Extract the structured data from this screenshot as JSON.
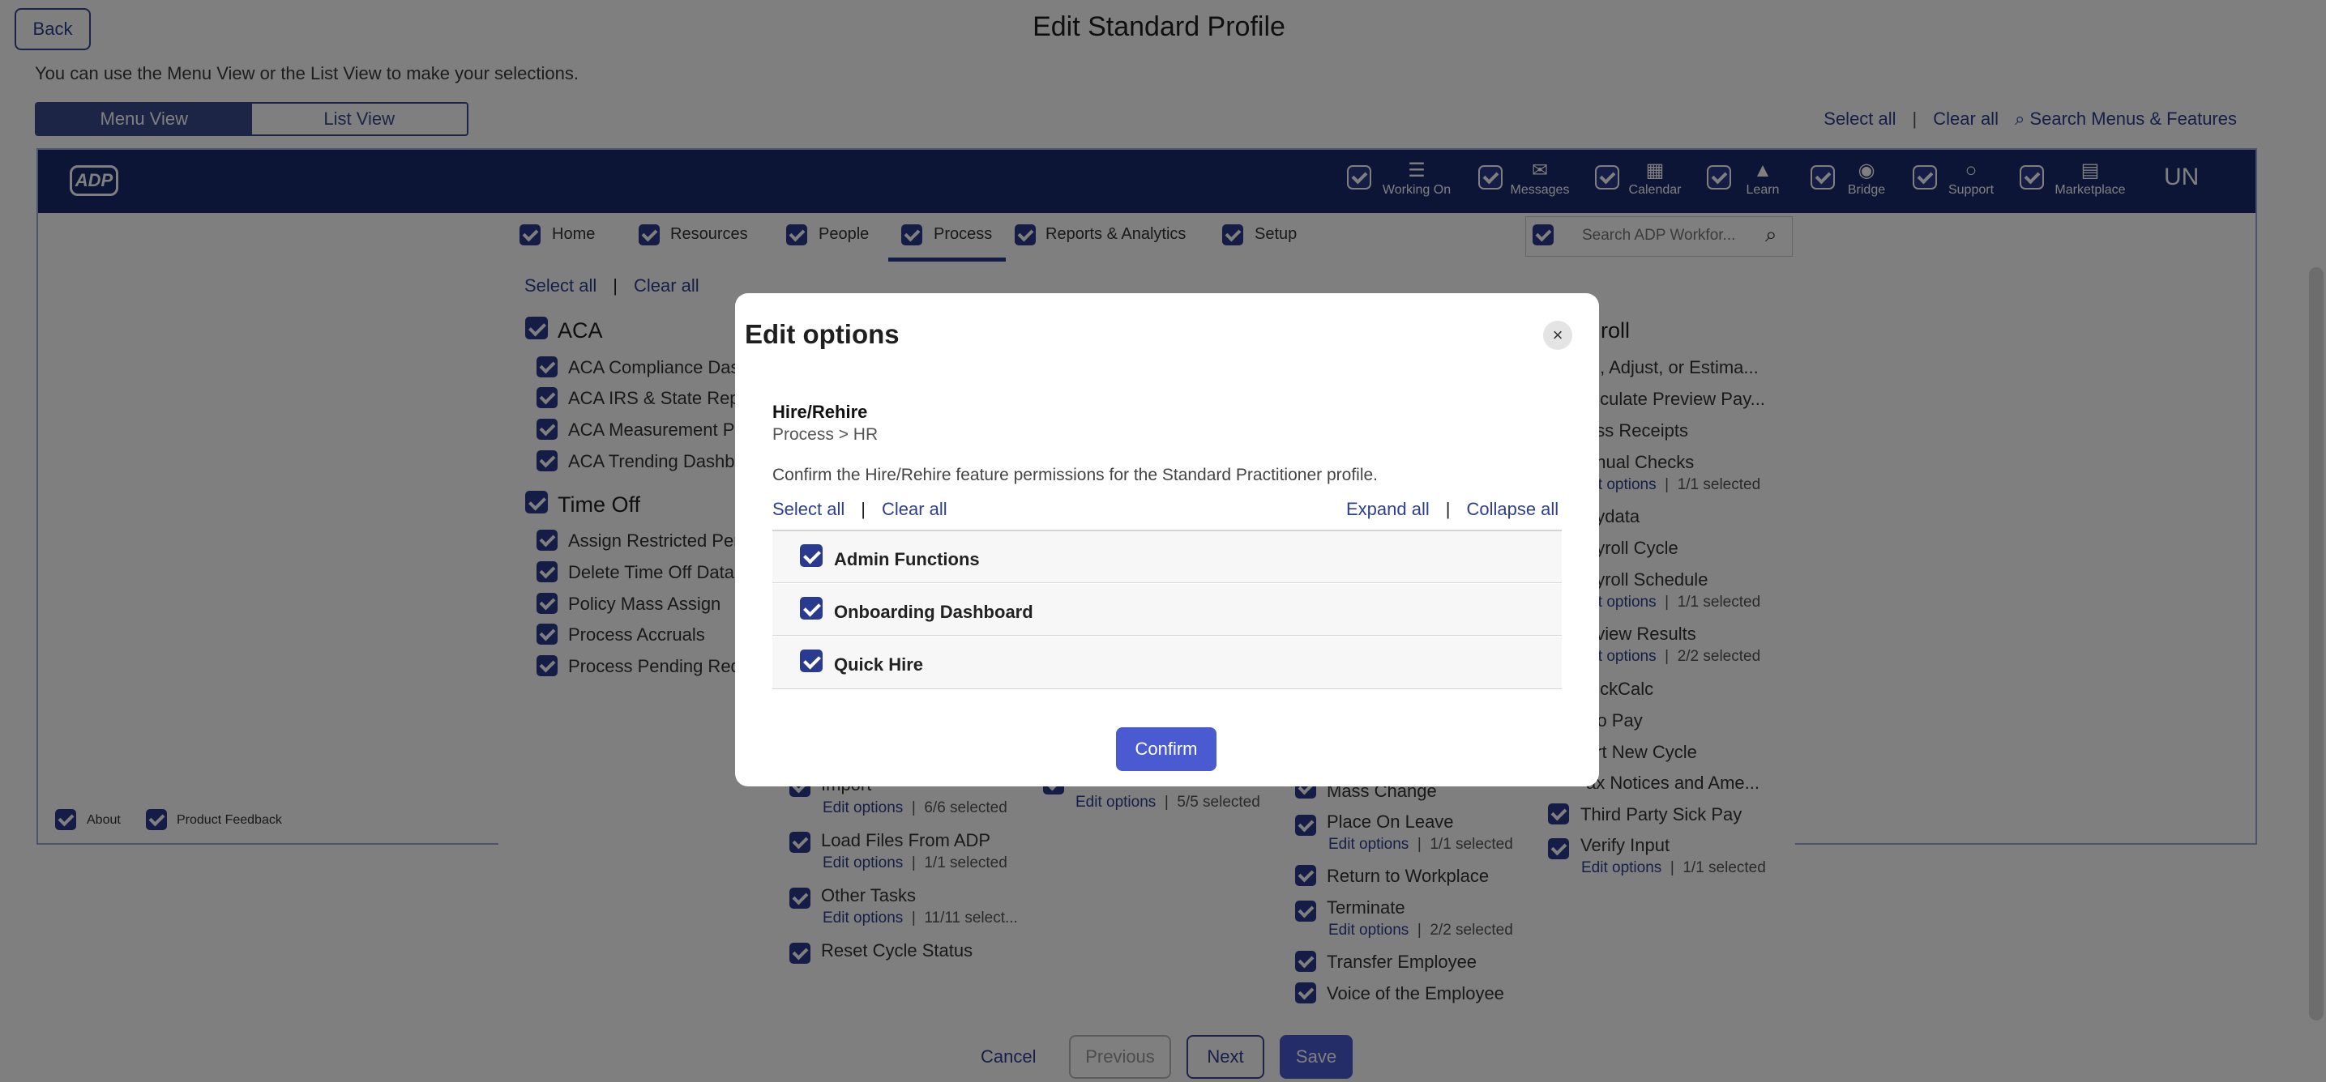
{
  "page": {
    "title": "Edit Standard Profile",
    "back_label": "Back",
    "instructions": "You can use the Menu View or the List View to make your selections.",
    "view_toggle": {
      "menu": "Menu View",
      "list": "List View"
    },
    "select_all": "Select all",
    "clear_all": "Clear all",
    "search_menus": "Search Menus & Features",
    "separator": "|"
  },
  "adp": {
    "logo": "ADP",
    "nav_icons": [
      {
        "label": "Working On",
        "icon": "stack-icon"
      },
      {
        "label": "Messages",
        "icon": "envelope-icon"
      },
      {
        "label": "Calendar",
        "icon": "calendar-icon"
      },
      {
        "label": "Learn",
        "icon": "graduation-cap-icon"
      },
      {
        "label": "Bridge",
        "icon": "bridge-icon"
      },
      {
        "label": "Support",
        "icon": "chat-bubble-icon"
      },
      {
        "label": "Marketplace",
        "icon": "shopping-bag-icon"
      }
    ],
    "user_initials": "UN",
    "tabs": [
      "Home",
      "Resources",
      "People",
      "Process",
      "Reports & Analytics",
      "Setup"
    ],
    "active_tab": "Process",
    "search_placeholder": "Search ADP Workfor...",
    "footer": {
      "about": "About",
      "feedback": "Product Feedback"
    }
  },
  "menu": {
    "select_all": "Select all",
    "clear_all": "Clear all",
    "aca": {
      "title": "ACA",
      "items": [
        "ACA Compliance Das",
        "ACA IRS & State Repo",
        "ACA Measurement Pe",
        "ACA Trending Dashbo"
      ]
    },
    "time_off": {
      "title": "Time Off",
      "items": [
        "Assign Restricted Per",
        "Delete Time Off Data",
        "Policy Mass Assign",
        "Process Accruals",
        "Process Pending Requ"
      ]
    },
    "col2": {
      "import": {
        "label": "Import",
        "edit": "Edit options",
        "count": "6/6 selected"
      },
      "load_files": {
        "label": "Load Files From ADP",
        "edit": "Edit options",
        "count": "1/1 selected"
      },
      "other_tasks": {
        "label": "Other Tasks",
        "edit": "Edit options",
        "count": "11/11 select..."
      },
      "reset_cycle": {
        "label": "Reset Cycle Status"
      }
    },
    "col3": {
      "edit": "Edit options",
      "count": "5/5 selected"
    },
    "col4": {
      "mass_change": "Mass Change",
      "place_on_leave": {
        "label": "Place On Leave",
        "edit": "Edit options",
        "count": "1/1 selected"
      },
      "return": "Return to Workplace",
      "terminate": {
        "label": "Terminate",
        "edit": "Edit options",
        "count": "2/2 selected"
      },
      "transfer": "Transfer Employee",
      "voice": "Voice of the Employee"
    },
    "payroll": {
      "title": "roll",
      "items": [
        {
          "label": "ld, Adjust, or Estima..."
        },
        {
          "label": "alculate Preview Pay..."
        },
        {
          "label": "oss Receipts"
        },
        {
          "label": "anual Checks",
          "edit": "dit options",
          "count": "1/1 selected"
        },
        {
          "label": "aydata"
        },
        {
          "label": "ayroll Cycle"
        },
        {
          "label": "ayroll Schedule",
          "edit": "dit options",
          "count": "1/1 selected"
        },
        {
          "label": "eview Results",
          "edit": "dit options",
          "count": "2/2 selected"
        },
        {
          "label": "uickCalc"
        },
        {
          "label": "tro Pay"
        },
        {
          "label": "art New Cycle"
        },
        {
          "label": "ax Notices and Ame..."
        }
      ],
      "third_party": "Third Party Sick Pay",
      "verify": {
        "label": "Verify Input",
        "edit": "Edit options",
        "count": "1/1 selected"
      }
    }
  },
  "bottom": {
    "cancel": "Cancel",
    "previous": "Previous",
    "next": "Next",
    "save": "Save"
  },
  "modal": {
    "title": "Edit options",
    "close_glyph": "×",
    "feature": "Hire/Rehire",
    "path": "Process > HR",
    "confirm_text": "Confirm the Hire/Rehire feature permissions for the Standard Practitioner profile.",
    "select_all": "Select all",
    "clear_all": "Clear all",
    "expand_all": "Expand all",
    "collapse_all": "Collapse all",
    "options": [
      "Admin Functions",
      "Onboarding Dashboard",
      "Quick Hire"
    ],
    "confirm_button": "Confirm"
  }
}
